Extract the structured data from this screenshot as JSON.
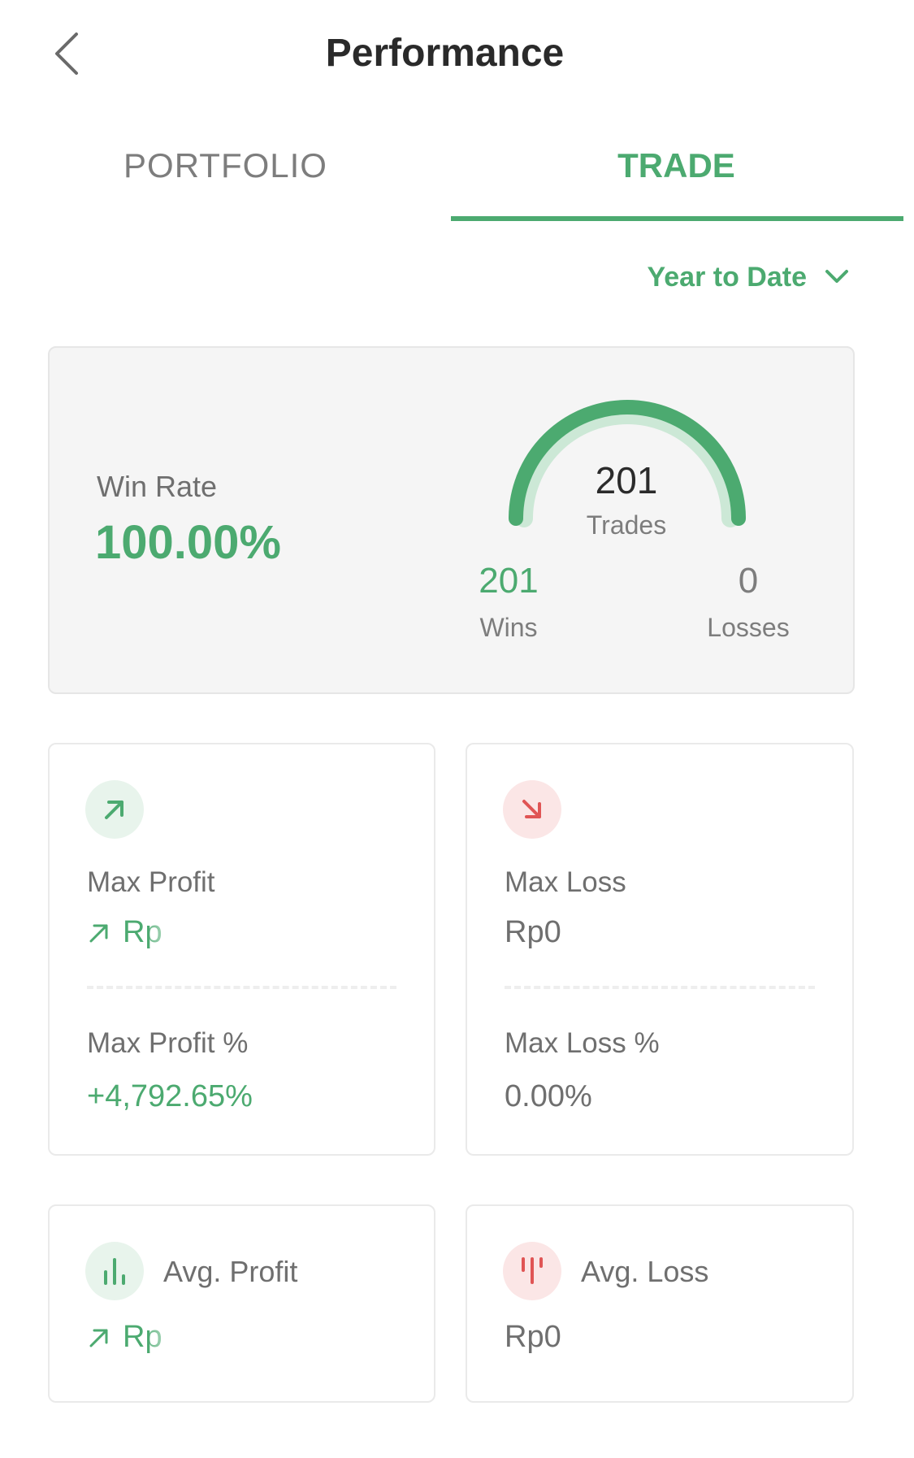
{
  "header": {
    "title": "Performance",
    "back_icon": "chevron-left-icon"
  },
  "tabs": [
    {
      "label": "PORTFOLIO",
      "active": false
    },
    {
      "label": "TRADE",
      "active": true
    }
  ],
  "period": {
    "selected": "Year to Date",
    "icon": "chevron-down-icon"
  },
  "summary": {
    "win_rate_label": "Win Rate",
    "win_rate_value": "100.00%",
    "total_trades": "201",
    "total_trades_label": "Trades",
    "wins": "201",
    "wins_label": "Wins",
    "losses": "0",
    "losses_label": "Losses",
    "win_fraction": 1.0
  },
  "stats": {
    "max_profit": {
      "label": "Max Profit",
      "value": "Rp",
      "icon": "arrow-up-right-icon",
      "percent_label": "Max Profit %",
      "percent_value": "+4,792.65%"
    },
    "max_loss": {
      "label": "Max Loss",
      "value": "Rp0",
      "icon": "arrow-down-right-icon",
      "percent_label": "Max Loss %",
      "percent_value": "0.00%"
    },
    "avg_profit": {
      "label": "Avg. Profit",
      "value": "Rp",
      "icon": "bar-chart-up-icon"
    },
    "avg_loss": {
      "label": "Avg. Loss",
      "value": "Rp0",
      "icon": "bar-chart-down-icon"
    }
  },
  "colors": {
    "accent_green": "#4caa70",
    "light_green": "#cce8d6",
    "accent_red": "#e05555",
    "text_gray": "#6f6f6f"
  }
}
